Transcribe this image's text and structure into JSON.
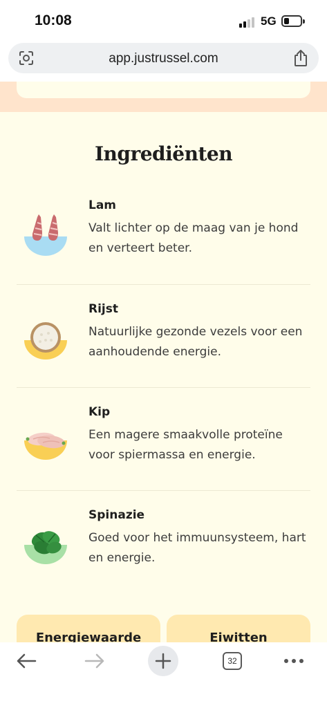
{
  "status_bar": {
    "time": "10:08",
    "network": "5G"
  },
  "browser": {
    "url": "app.justrussel.com",
    "tab_count": "32"
  },
  "ingredients": {
    "title": "Ingrediënten",
    "items": [
      {
        "name": "Lam",
        "description": "Valt lichter op de maag van je hond en verteert beter.",
        "icon": "lamb-icon",
        "bowl_color": "#a9dcf3"
      },
      {
        "name": "Rijst",
        "description": "Natuurlijke gezonde vezels voor een aanhoudende energie.",
        "icon": "rice-icon",
        "bowl_color": "#f9cf55"
      },
      {
        "name": "Kip",
        "description": "Een magere smaakvolle proteïne voor spiermassa en energie.",
        "icon": "chicken-icon",
        "bowl_color": "#f9cf55"
      },
      {
        "name": "Spinazie",
        "description": "Goed voor het immuunsysteem, hart en energie.",
        "icon": "spinach-icon",
        "bowl_color": "#a8e0a6"
      }
    ]
  },
  "nutrition_cards": [
    {
      "label": "Energiewaarde"
    },
    {
      "label": "Eiwitten"
    }
  ],
  "colors": {
    "page_background": "#fffdea",
    "peach_band": "#ffe4cc",
    "card_yellow": "#ffe9b0"
  }
}
